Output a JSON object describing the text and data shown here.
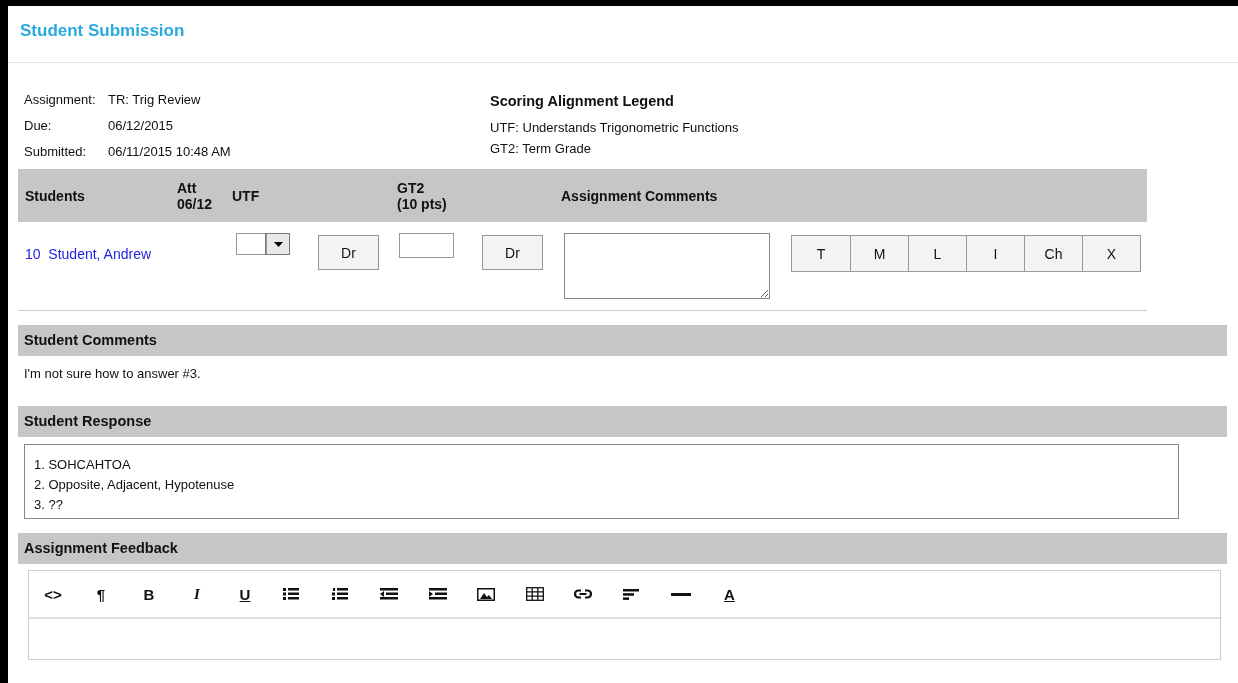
{
  "page": {
    "title": "Student Submission"
  },
  "details": [
    {
      "label": "Assignment:",
      "value": "TR: Trig Review"
    },
    {
      "label": "Due:",
      "value": "06/12/2015"
    },
    {
      "label": "Submitted:",
      "value": "06/11/2015 10:48 AM"
    }
  ],
  "legend": {
    "title": "Scoring Alignment Legend",
    "items": [
      "UTF: Understands Trigonometric Functions",
      "GT2: Term Grade"
    ]
  },
  "table": {
    "columns": [
      [
        "Students"
      ],
      [
        "Att",
        "06/12"
      ],
      [
        "UTF"
      ],
      [
        "GT2",
        "(10 pts)"
      ],
      [
        "Assignment Comments"
      ]
    ],
    "rows": [
      {
        "number": "10",
        "student": "Student, Andrew",
        "utf_button": "Dr",
        "gt2_button": "Dr",
        "comment_buttons": [
          "T",
          "M",
          "L",
          "I",
          "Ch",
          "X"
        ]
      }
    ]
  },
  "student_comments": {
    "title": "Student Comments",
    "text": "I'm not sure how to answer #3."
  },
  "student_response": {
    "title": "Student Response",
    "lines": [
      "1. SOHCAHTOA",
      "2. Opposite, Adjacent, Hypotenuse",
      "3. ??"
    ]
  },
  "assignment_feedback": {
    "title": "Assignment Feedback",
    "toolbar": [
      {
        "kind": "glyph",
        "label": "<>"
      },
      {
        "kind": "glyph",
        "label": "¶"
      },
      {
        "kind": "bold",
        "label": "B"
      },
      {
        "kind": "italic",
        "label": "I"
      },
      {
        "kind": "underline",
        "label": "U"
      },
      {
        "kind": "bullets"
      },
      {
        "kind": "numbers"
      },
      {
        "kind": "outdent"
      },
      {
        "kind": "indent"
      },
      {
        "kind": "image"
      },
      {
        "kind": "table"
      },
      {
        "kind": "link"
      },
      {
        "kind": "align"
      },
      {
        "kind": "rule"
      },
      {
        "kind": "color",
        "label": "A"
      }
    ]
  }
}
